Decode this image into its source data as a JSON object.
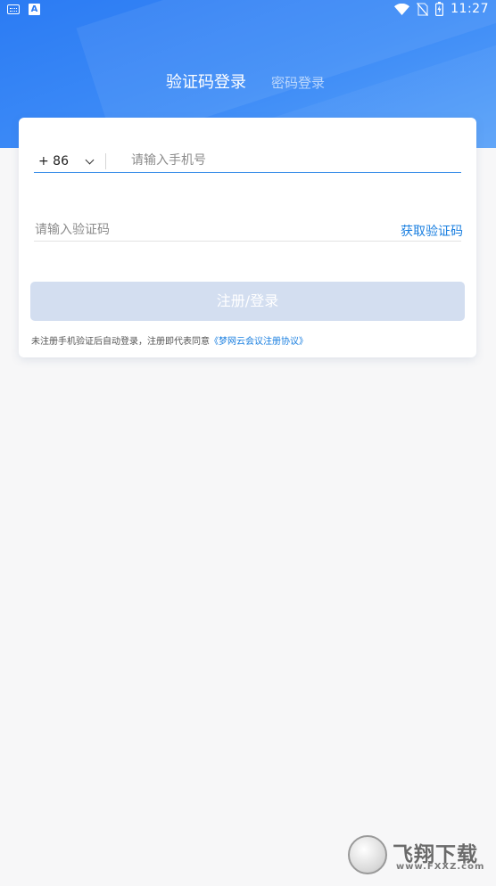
{
  "status_bar": {
    "time": "11:27",
    "keyboard_icon": "keyboard-icon",
    "a_icon_text": "A",
    "wifi_icon": "wifi-icon",
    "sim_icon": "no-sim-icon",
    "battery_icon": "battery-charging-icon"
  },
  "tabs": {
    "active_label": "验证码登录",
    "inactive_label": "密码登录"
  },
  "form": {
    "country_code": "+ 86",
    "phone_placeholder": "请输入手机号",
    "code_placeholder": "请输入验证码",
    "get_code_label": "获取验证码",
    "submit_label": "注册/登录",
    "agreement_text": "未注册手机验证后自动登录，注册即代表同意",
    "agreement_link": "《梦网云会议注册协议》"
  },
  "colors": {
    "header_blue": "#2b7bf3",
    "link_blue": "#1a7fe0",
    "button_disabled": "#d3def0",
    "background": "#f7f7f8"
  },
  "watermark": {
    "brand": "飞翔下载",
    "url": "www.FXXZ.com"
  }
}
